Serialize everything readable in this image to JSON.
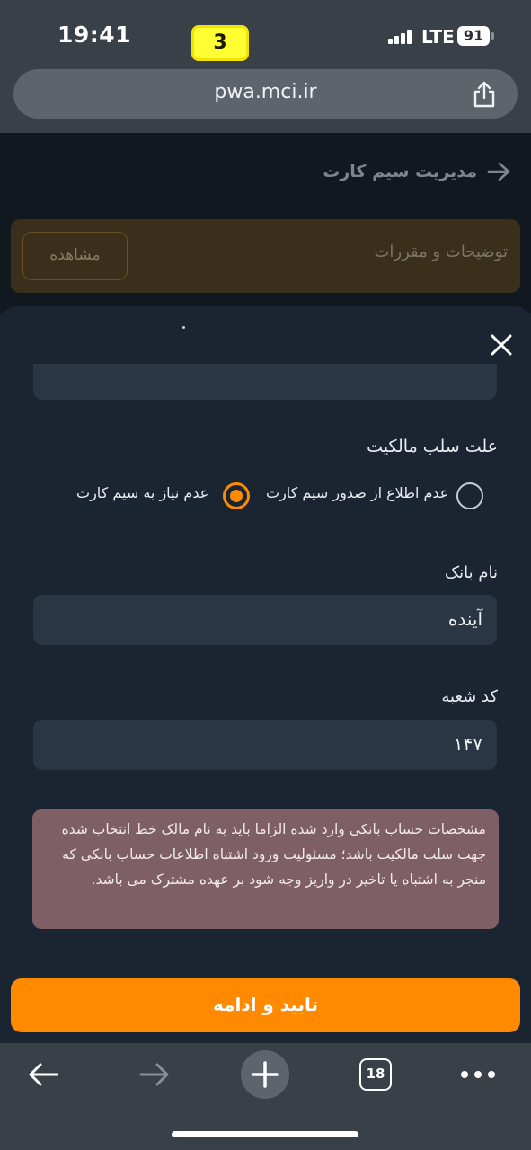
{
  "status_bar": {
    "time": "19:41",
    "badge": "3",
    "network": "LTE",
    "battery": "91"
  },
  "browser": {
    "url": "pwa.mci.ir",
    "tab_count": "18"
  },
  "page": {
    "title": "مدیریت سیم کارت",
    "notice_label": "توضیحات و مقررات",
    "view_button": "مشاهده"
  },
  "sheet": {
    "reason_label": "علت سلب مالکیت",
    "radio_options": [
      {
        "label": "عدم اطلاع از صدور سیم کارت",
        "selected": false
      },
      {
        "label": "عدم نیاز به سیم کارت",
        "selected": true
      }
    ],
    "bank_label": "نام بانک",
    "bank_value": "آینده",
    "branch_label": "کد شعبه",
    "branch_value": "۱۴۷",
    "warning_text": "مشخصات حساب بانکی وارد شده الزاما باید به نام مالک خط انتخاب شده جهت سلب مالکیت باشد؛ مسئولیت ورود اشتباه اطلاعات حساب بانکی که منجر به اشتباه یا تاخیر در واریز وجه شود بر عهده مشترک می باشد.",
    "confirm_button": "تایید و ادامه"
  },
  "colors": {
    "accent": "#ff8a00",
    "warning_bg": "#7f5f66",
    "sheet_bg": "#1b2532"
  }
}
